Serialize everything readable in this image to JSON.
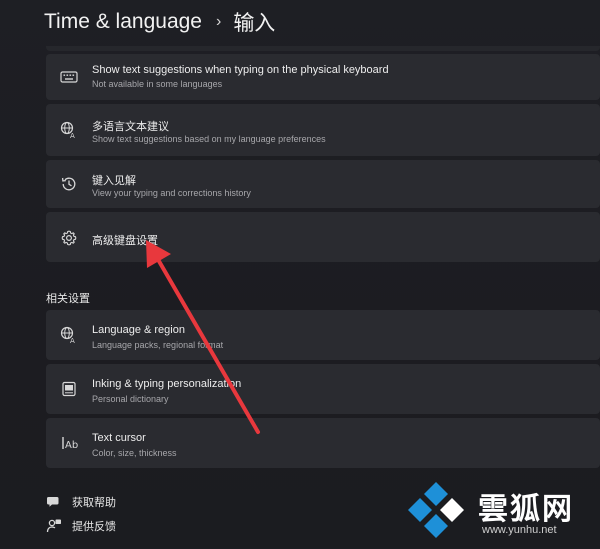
{
  "header": {
    "section": "Time & language",
    "page": "输入"
  },
  "cards": [
    {
      "title": "Show text suggestions when typing on the physical keyboard",
      "subtitle": "Not available in some languages",
      "icon": "keyboard-icon"
    },
    {
      "title": "多语言文本建议",
      "subtitle": "Show text suggestions based on my language preferences",
      "icon": "language-icon"
    },
    {
      "title": "键入见解",
      "subtitle": "View your typing and corrections history",
      "icon": "history-icon"
    },
    {
      "title": "高级键盘设置",
      "icon": "gear-icon"
    }
  ],
  "related": {
    "label": "相关设置",
    "items": [
      {
        "title": "Language & region",
        "subtitle": "Language packs, regional format",
        "icon": "language-icon"
      },
      {
        "title": "Inking & typing personalization",
        "subtitle": "Personal dictionary",
        "icon": "dictionary-icon"
      },
      {
        "title": "Text cursor",
        "subtitle": "Color, size, thickness",
        "icon": "text-cursor-icon"
      }
    ]
  },
  "footer": {
    "help": "获取帮助",
    "feedback": "提供反馈"
  },
  "watermark": {
    "brand": "雲狐网",
    "url": "www.yunhu.net"
  },
  "colors": {
    "background": "#1c1d22",
    "card": "#2a2b30",
    "annotation_arrow": "#e8383d",
    "logo_blue": "#1e90d8"
  }
}
